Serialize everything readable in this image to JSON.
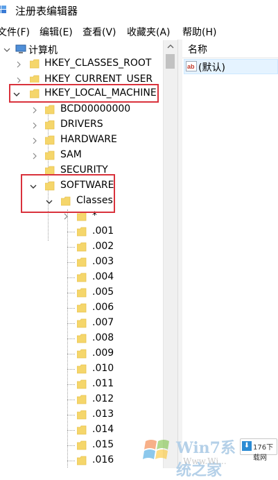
{
  "window": {
    "title": "注册表编辑器"
  },
  "menu": [
    "文件(F)",
    "编辑(E)",
    "查看(V)",
    "收藏夹(A)",
    "帮助(H)"
  ],
  "tree": {
    "root": "计算机",
    "hives": [
      "HKEY_CLASSES_ROOT",
      "HKEY_CURRENT_USER",
      "HKEY_LOCAL_MACHINE"
    ],
    "hklm_children": [
      "BCD00000000",
      "DRIVERS",
      "HARDWARE",
      "SAM",
      "SECURITY",
      "SOFTWARE"
    ],
    "software_children": [
      "Classes"
    ],
    "classes_children": [
      "*",
      ".001",
      ".002",
      ".003",
      ".004",
      ".005",
      ".006",
      ".007",
      ".008",
      ".009",
      ".010",
      ".011",
      ".012",
      ".013",
      ".014",
      ".015",
      ".016"
    ]
  },
  "list": {
    "column_name": "名称",
    "values": [
      "(默认)"
    ]
  },
  "watermarks": {
    "win7": "Win7系统之家",
    "win7_url": "Www.Wi...",
    "site": "176下载网"
  },
  "colors": {
    "highlight": "#d9313b",
    "folder": "#f5d66b",
    "folder_dark": "#e8c14c",
    "selection": "#e5f3ff"
  }
}
